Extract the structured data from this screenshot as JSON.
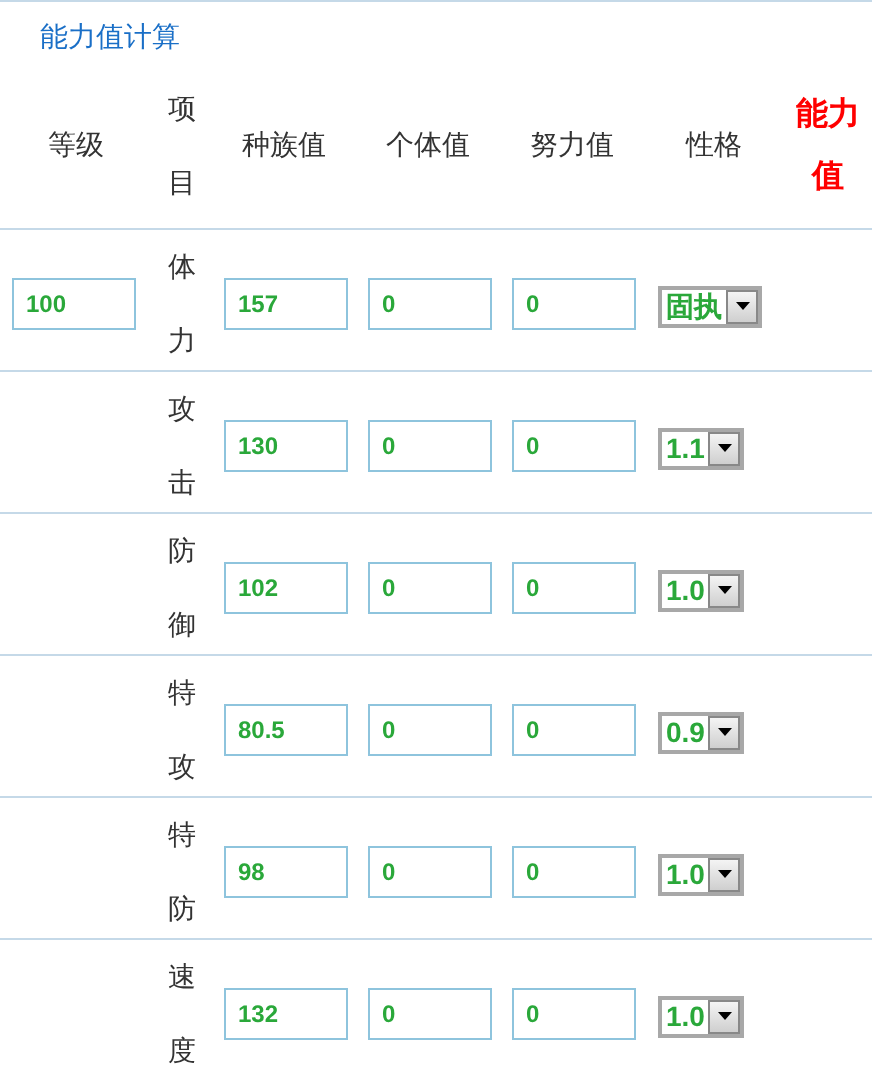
{
  "title": "能力值计算",
  "headers": [
    "等级",
    "项目",
    "种族值",
    "个体值",
    "努力值",
    "性格",
    "能力值"
  ],
  "level": "100",
  "rows": [
    {
      "stat": "体力",
      "base": "157",
      "iv": "0",
      "ev": "0",
      "nature": "固执"
    },
    {
      "stat": "攻击",
      "base": "130",
      "iv": "0",
      "ev": "0",
      "nature": "1.1"
    },
    {
      "stat": "防御",
      "base": "102",
      "iv": "0",
      "ev": "0",
      "nature": "1.0"
    },
    {
      "stat": "特攻",
      "base": "80.5",
      "iv": "0",
      "ev": "0",
      "nature": "0.9"
    },
    {
      "stat": "特防",
      "base": "98",
      "iv": "0",
      "ev": "0",
      "nature": "1.0"
    },
    {
      "stat": "速度",
      "base": "132",
      "iv": "0",
      "ev": "0",
      "nature": "1.0"
    }
  ]
}
